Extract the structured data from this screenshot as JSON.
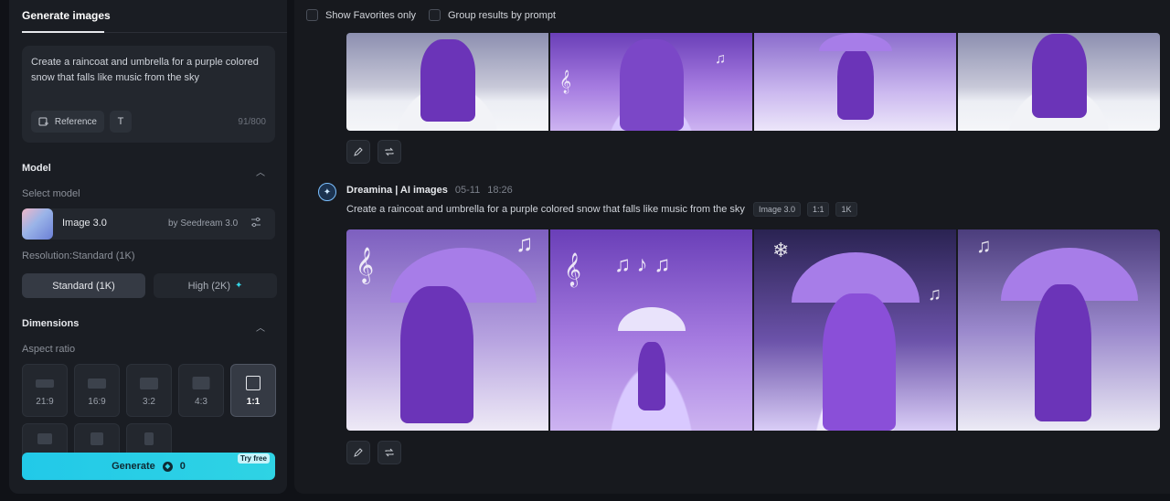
{
  "left_panel": {
    "tab_label": "Generate images",
    "prompt_text": "Create a raincoat and umbrella for a purple colored snow that falls like music from the sky",
    "reference_label": "Reference",
    "text_tool_label": "T",
    "char_count": "91/800",
    "model_section": {
      "title": "Model",
      "select_label": "Select model",
      "model_name": "Image 3.0",
      "model_by": "by Seedream 3.0"
    },
    "resolution": {
      "label": "Resolution:Standard (1K)",
      "options": [
        "Standard (1K)",
        "High (2K)"
      ],
      "selected": "Standard (1K)"
    },
    "dimensions": {
      "title": "Dimensions",
      "aspect_label": "Aspect ratio",
      "ratios": [
        "21:9",
        "16:9",
        "3:2",
        "4:3",
        "1:1"
      ],
      "selected": "1:1"
    },
    "generate": {
      "label": "Generate",
      "cost": "0",
      "badge": "Try free"
    }
  },
  "right_panel": {
    "show_favorites_label": "Show Favorites only",
    "group_by_prompt_label": "Group results by prompt",
    "generation": {
      "author": "Dreamina | AI images",
      "date": "05-11",
      "time": "18:26",
      "prompt": "Create a raincoat and umbrella for a purple colored snow that falls like music from the sky",
      "tags": [
        "Image 3.0",
        "1:1",
        "1K"
      ]
    }
  },
  "icons": {
    "reference": "image-plus-icon",
    "settings": "sliders-icon",
    "edit": "pencil-icon",
    "regenerate": "repeat-icon",
    "chevron": "chevron-up-icon",
    "avatar": "dreamina-logo-icon"
  },
  "colors": {
    "accent": "#2fd3e4",
    "panel": "#1a1d23",
    "background": "#101217"
  }
}
